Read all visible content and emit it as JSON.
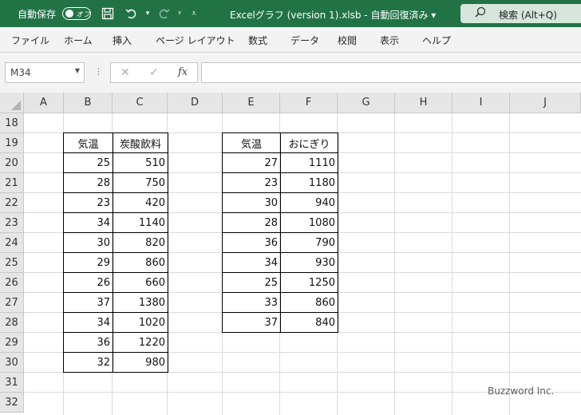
{
  "titlebar": {
    "autosave_label": "自動保存",
    "autosave_state": "オフ",
    "filename": "Excelグラフ (version 1).xlsb  -  自動回復済み ▾",
    "search_label": "検索 (Alt+Q)",
    "icons": [
      "save-icon",
      "undo-icon",
      "redo-icon",
      "customize-icon",
      "search-icon"
    ]
  },
  "menu": {
    "items": [
      "ファイル",
      "ホーム",
      "挿入",
      "ページ レイアウト",
      "数式",
      "データ",
      "校閲",
      "表示",
      "ヘルプ"
    ]
  },
  "formula_bar": {
    "name_box": "M34",
    "fx_label": "fx",
    "formula": ""
  },
  "sheet": {
    "columns": [
      "A",
      "B",
      "C",
      "D",
      "E",
      "F",
      "G",
      "H",
      "I",
      "J"
    ],
    "rows": [
      "18",
      "19",
      "20",
      "21",
      "22",
      "23",
      "24",
      "25",
      "26",
      "27",
      "28",
      "29",
      "30",
      "31",
      "32"
    ],
    "table1": {
      "headers": [
        "気温",
        "炭酸飲料"
      ],
      "rows": [
        [
          "25",
          "510"
        ],
        [
          "28",
          "750"
        ],
        [
          "23",
          "420"
        ],
        [
          "34",
          "1140"
        ],
        [
          "30",
          "820"
        ],
        [
          "29",
          "860"
        ],
        [
          "26",
          "660"
        ],
        [
          "37",
          "1380"
        ],
        [
          "34",
          "1020"
        ],
        [
          "36",
          "1220"
        ],
        [
          "32",
          "980"
        ]
      ]
    },
    "table2": {
      "headers": [
        "気温",
        "おにぎり"
      ],
      "rows": [
        [
          "27",
          "1110"
        ],
        [
          "23",
          "1180"
        ],
        [
          "30",
          "940"
        ],
        [
          "28",
          "1080"
        ],
        [
          "36",
          "790"
        ],
        [
          "34",
          "930"
        ],
        [
          "25",
          "1250"
        ],
        [
          "33",
          "860"
        ],
        [
          "37",
          "840"
        ]
      ]
    }
  },
  "watermark": "Buzzword Inc.",
  "colors": {
    "accent": "#217346"
  }
}
